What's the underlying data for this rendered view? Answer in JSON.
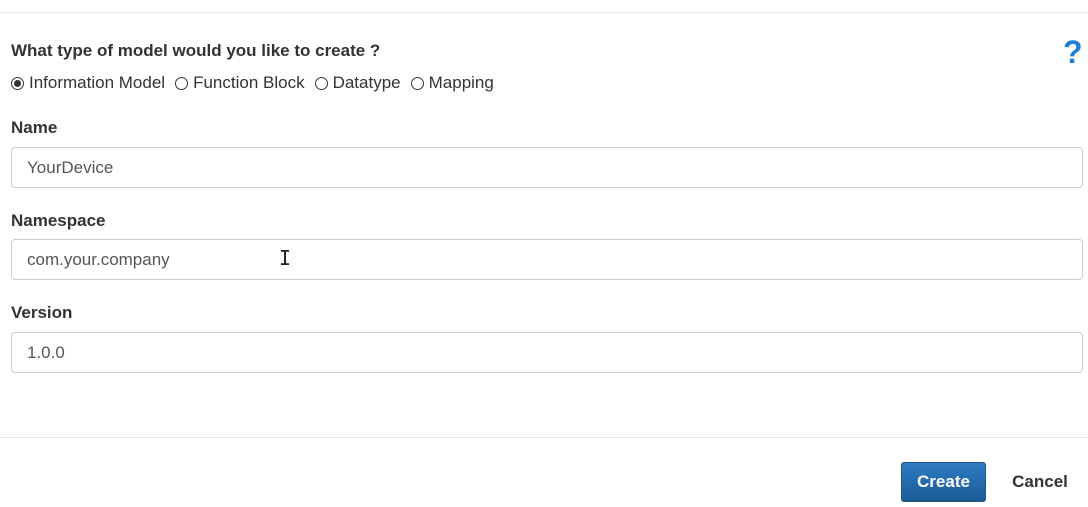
{
  "form": {
    "question": "What type of model would you like to create ?",
    "help_icon": "?",
    "model_types": [
      {
        "label": "Information Model",
        "checked": true
      },
      {
        "label": "Function Block",
        "checked": false
      },
      {
        "label": "Datatype",
        "checked": false
      },
      {
        "label": "Mapping",
        "checked": false
      }
    ],
    "name": {
      "label": "Name",
      "value": "YourDevice"
    },
    "namespace": {
      "label": "Namespace",
      "value": "com.your.company"
    },
    "version": {
      "label": "Version",
      "value": "1.0.0"
    }
  },
  "footer": {
    "create_label": "Create",
    "cancel_label": "Cancel"
  },
  "colors": {
    "accent": "#1f7fd6",
    "button_primary": "#1a5b97"
  }
}
